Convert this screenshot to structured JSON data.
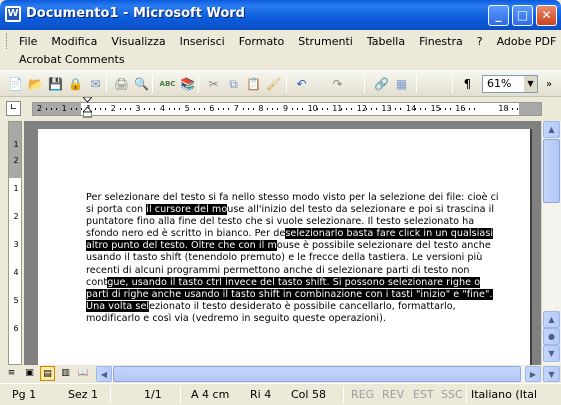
{
  "window": {
    "title": "Documento1 - Microsoft Word",
    "app_icon": "W",
    "controls": {
      "minimize": "_",
      "maximize": "□",
      "close": "✕"
    }
  },
  "menu": {
    "items": [
      "File",
      "Modifica",
      "Visualizza",
      "Inserisci",
      "Formato",
      "Strumenti",
      "Tabella",
      "Finestra",
      "?",
      "Adobe PDF"
    ],
    "row2": [
      "Acrobat Comments"
    ]
  },
  "toolbar": {
    "icons": [
      "new-document-icon",
      "open-icon",
      "save-icon",
      "permission-icon",
      "email-icon",
      "print-icon",
      "print-preview-icon",
      "spelling-icon",
      "research-icon",
      "cut-icon",
      "copy-icon",
      "paste-icon",
      "format-painter-icon",
      "undo-icon",
      "redo-icon",
      "hyperlink-icon",
      "table-icon",
      "show-formatting-icon"
    ],
    "zoom": "61%",
    "zoom_dropdown": "▼",
    "overflow": "»"
  },
  "ruler": {
    "corner_glyph": "∟",
    "h_ticks": [
      "2",
      "1",
      "1",
      "2",
      "3",
      "4",
      "5",
      "6",
      "7",
      "8",
      "9",
      "10",
      "11",
      "12",
      "13",
      "14",
      "15",
      "16",
      "18"
    ],
    "v_ticks": [
      "1",
      "2",
      "1",
      "2",
      "3",
      "4",
      "5",
      "6"
    ]
  },
  "document": {
    "segments": [
      {
        "text": "Per selezionare del testo si fa nello stesso modo visto per la selezione dei file: cioè ci si porta con ",
        "selected": false
      },
      {
        "text": "il cursore del mo",
        "selected": true
      },
      {
        "text": "use all'inizio del testo da selezionare e poi si trascina il puntatore fino alla fine del testo che si vuole selezionare. Il testo selezionato ha sfondo nero ed è scritto in bianco. Per de",
        "selected": false
      },
      {
        "text": "selezionarlo basta fare click in un qualsiasi altro punto del testo. Oltre che con il m",
        "selected": true
      },
      {
        "text": "ouse è possibile selezionare del testo anche usando il tasto shift (tenendolo premuto) e le frecce della tastiera. Le versioni più recenti di alcuni programmi permettono anche di selezionare parti di testo non cont",
        "selected": false
      },
      {
        "text": "gue, usando il tasto ctrl invece del tasto shift. Si possono selezionare righe o parti di righe anche usando il tasto shift in combinazione con i tasti \"inizio\" e \"fine\". Una volta sel",
        "selected": true
      },
      {
        "text": "ezionato il testo desiderato è possibile cancellarlo, formattarlo, modificarlo e così via (vedremo in seguito queste operazioni).",
        "selected": false
      }
    ]
  },
  "scrollbar": {
    "up": "▲",
    "down": "▼",
    "prev_page": "▲",
    "select_browse": "●",
    "next_page": "▼",
    "left": "◀",
    "right": "▶"
  },
  "view_buttons": [
    "≡",
    "▣",
    "▤",
    "▥",
    "📖"
  ],
  "status": {
    "page": "Pg 1",
    "section": "Sez 1",
    "pages": "1/1",
    "position": "A 4 cm",
    "line": "Ri 4",
    "column": "Col 58",
    "rec": "REG",
    "trk": "REV",
    "ext": "EST",
    "ovr": "SSC",
    "language": "Italiano (Ital"
  }
}
